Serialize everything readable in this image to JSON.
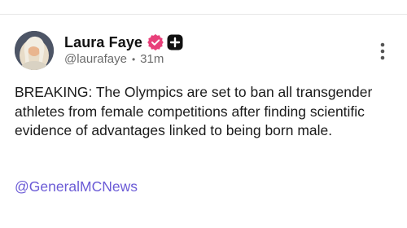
{
  "post": {
    "display_name": "Laura Faye",
    "handle": "@laurafaye",
    "separator": "•",
    "time_ago": "31m",
    "body": "BREAKING: The Olympics are set to ban all transgender athletes from female competitions after finding scientific evidence of advantages linked to being born male.",
    "mention": "@GeneralMCNews"
  },
  "icons": {
    "verified": "verified-badge-icon",
    "plus": "plus-badge-icon",
    "more": "vertical-ellipsis-icon"
  },
  "colors": {
    "accent_link": "#6b5bd6",
    "verified_badge": "#e8407a",
    "text_primary": "#111111",
    "text_secondary": "#6b6b6b"
  }
}
